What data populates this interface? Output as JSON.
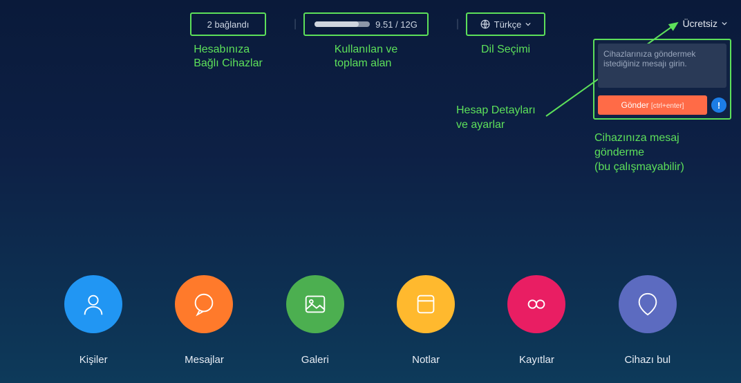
{
  "topbar": {
    "connected": "2 bağlandı",
    "storage_used": "9.51",
    "storage_total": "12G",
    "storage_text": "9.51 / 12G",
    "language": "Türkçe",
    "account": "Ücretsiz"
  },
  "annotations": {
    "connected": "Hesabınıza\nBağlı Cihazlar",
    "storage": "Kullanılan ve\ntoplam alan",
    "language": "Dil Seçimi",
    "account": "Hesap Detayları\nve ayarlar",
    "message": "Cihazınıza mesaj\ngönderme\n(bu çalışmayabilir)"
  },
  "message_panel": {
    "placeholder": "Cihazlarınıza göndermek istediğiniz mesajı girin.",
    "send": "Gönder",
    "hint": "[ctrl+enter]"
  },
  "apps": [
    {
      "label": "Kişiler",
      "color": "c-blue",
      "icon": "person"
    },
    {
      "label": "Mesajlar",
      "color": "c-orange",
      "icon": "chat"
    },
    {
      "label": "Galeri",
      "color": "c-green",
      "icon": "image"
    },
    {
      "label": "Notlar",
      "color": "c-yellow",
      "icon": "note"
    },
    {
      "label": "Kayıtlar",
      "color": "c-pink",
      "icon": "record"
    },
    {
      "label": "Cihazı bul",
      "color": "c-purple",
      "icon": "pin"
    }
  ]
}
